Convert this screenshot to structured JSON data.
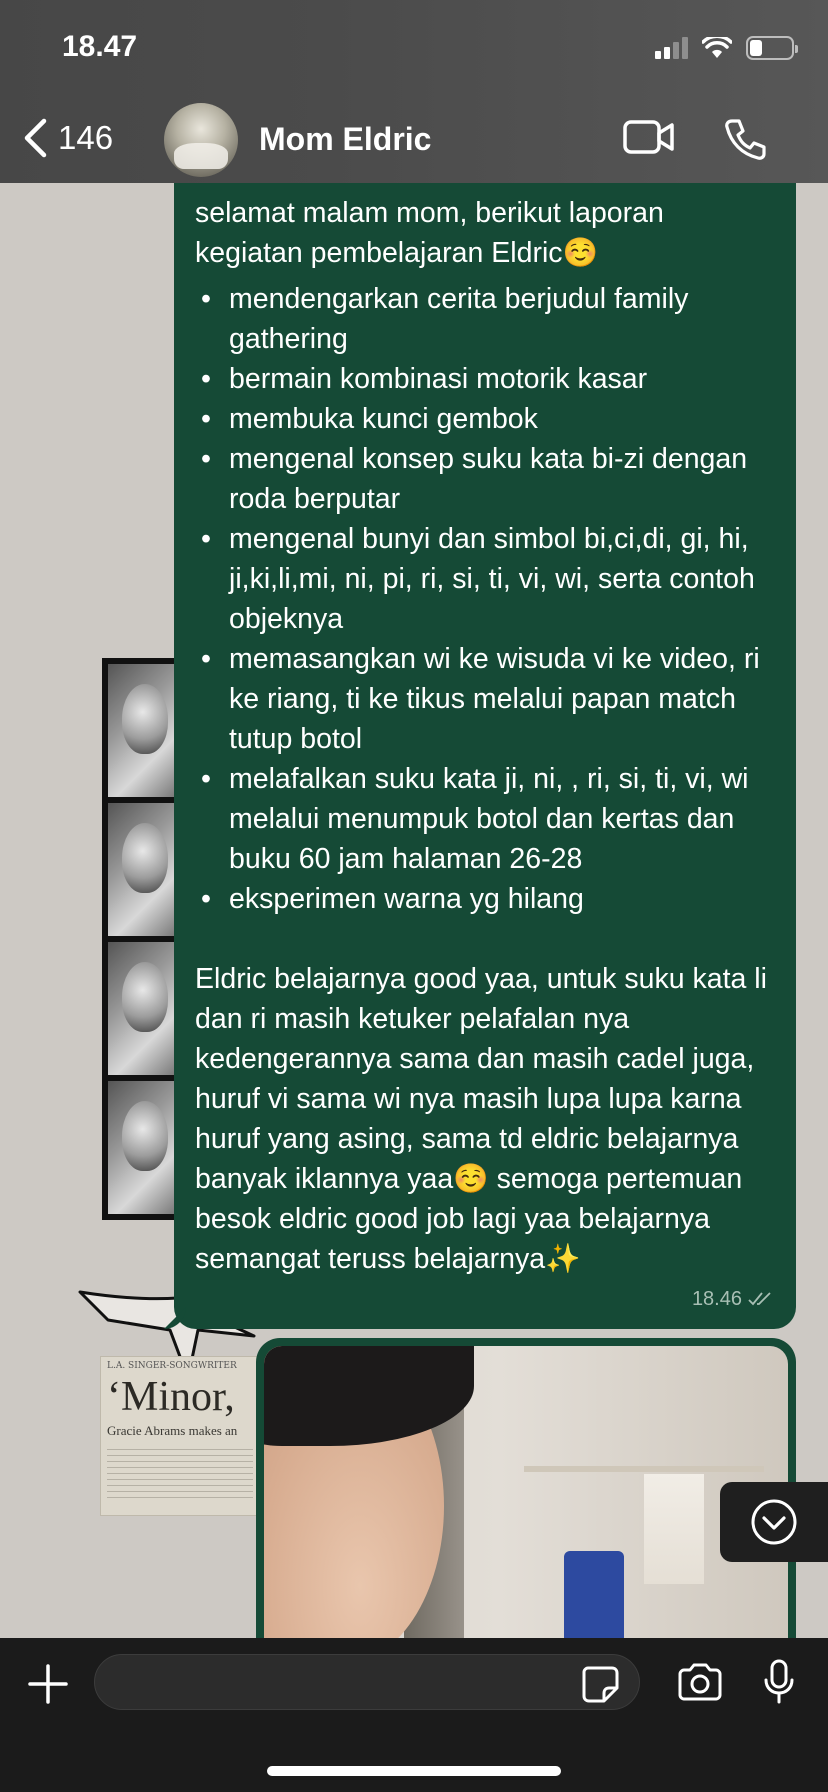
{
  "status_bar": {
    "time": "18.47"
  },
  "header": {
    "back_count": "146",
    "contact_name": "Mom Eldric"
  },
  "message": {
    "intro": "selamat malam mom, berikut laporan kegiatan pembelajaran Eldric☺️",
    "activities": [
      "mendengarkan cerita berjudul family gathering",
      "bermain kombinasi motorik kasar",
      "membuka kunci gembok",
      "mengenal konsep suku kata bi-zi dengan roda berputar",
      "mengenal bunyi dan simbol bi,ci,di, gi, hi, ji,ki,li,mi, ni, pi, ri, si, ti, vi, wi, serta contoh objeknya",
      "memasangkan wi ke wisuda vi ke video, ri ke riang, ti ke tikus melalui papan match tutup botol",
      "melafalkan suku kata ji, ni, , ri, si, ti, vi, wi melalui menumpuk botol dan kertas dan buku 60 jam halaman 26-28",
      "eksperimen warna yg hilang"
    ],
    "closing": "Eldric belajarnya good yaa, untuk suku kata li dan ri masih ketuker pelafalan nya kedengerannya sama dan masih cadel juga, huruf vi sama wi nya masih lupa lupa karna huruf yang asing, sama td eldric belajarnya banyak iklannya yaa☺️ semoga pertemuan besok eldric good job lagi yaa belajarnya semangat teruss belajarnya✨",
    "time": "18.46",
    "status": "read"
  },
  "wallpaper": {
    "newspaper_header": "L.A. SINGER-SONGWRITER",
    "newspaper_title": "‘Minor,",
    "newspaper_subtitle": "Gracie Abrams makes an"
  },
  "input": {
    "placeholder": ""
  },
  "icons": {
    "back": "chevron-left-icon",
    "video": "video-camera-icon",
    "call": "phone-icon",
    "scroll": "chevron-down-circle-icon",
    "plus": "plus-icon",
    "sticker": "sticker-icon",
    "camera": "camera-icon",
    "mic": "microphone-icon"
  },
  "colors": {
    "outgoing_bubble": "#154a36",
    "header_bg": "#4b4b4b",
    "input_bar_bg": "#1b1b1b"
  }
}
